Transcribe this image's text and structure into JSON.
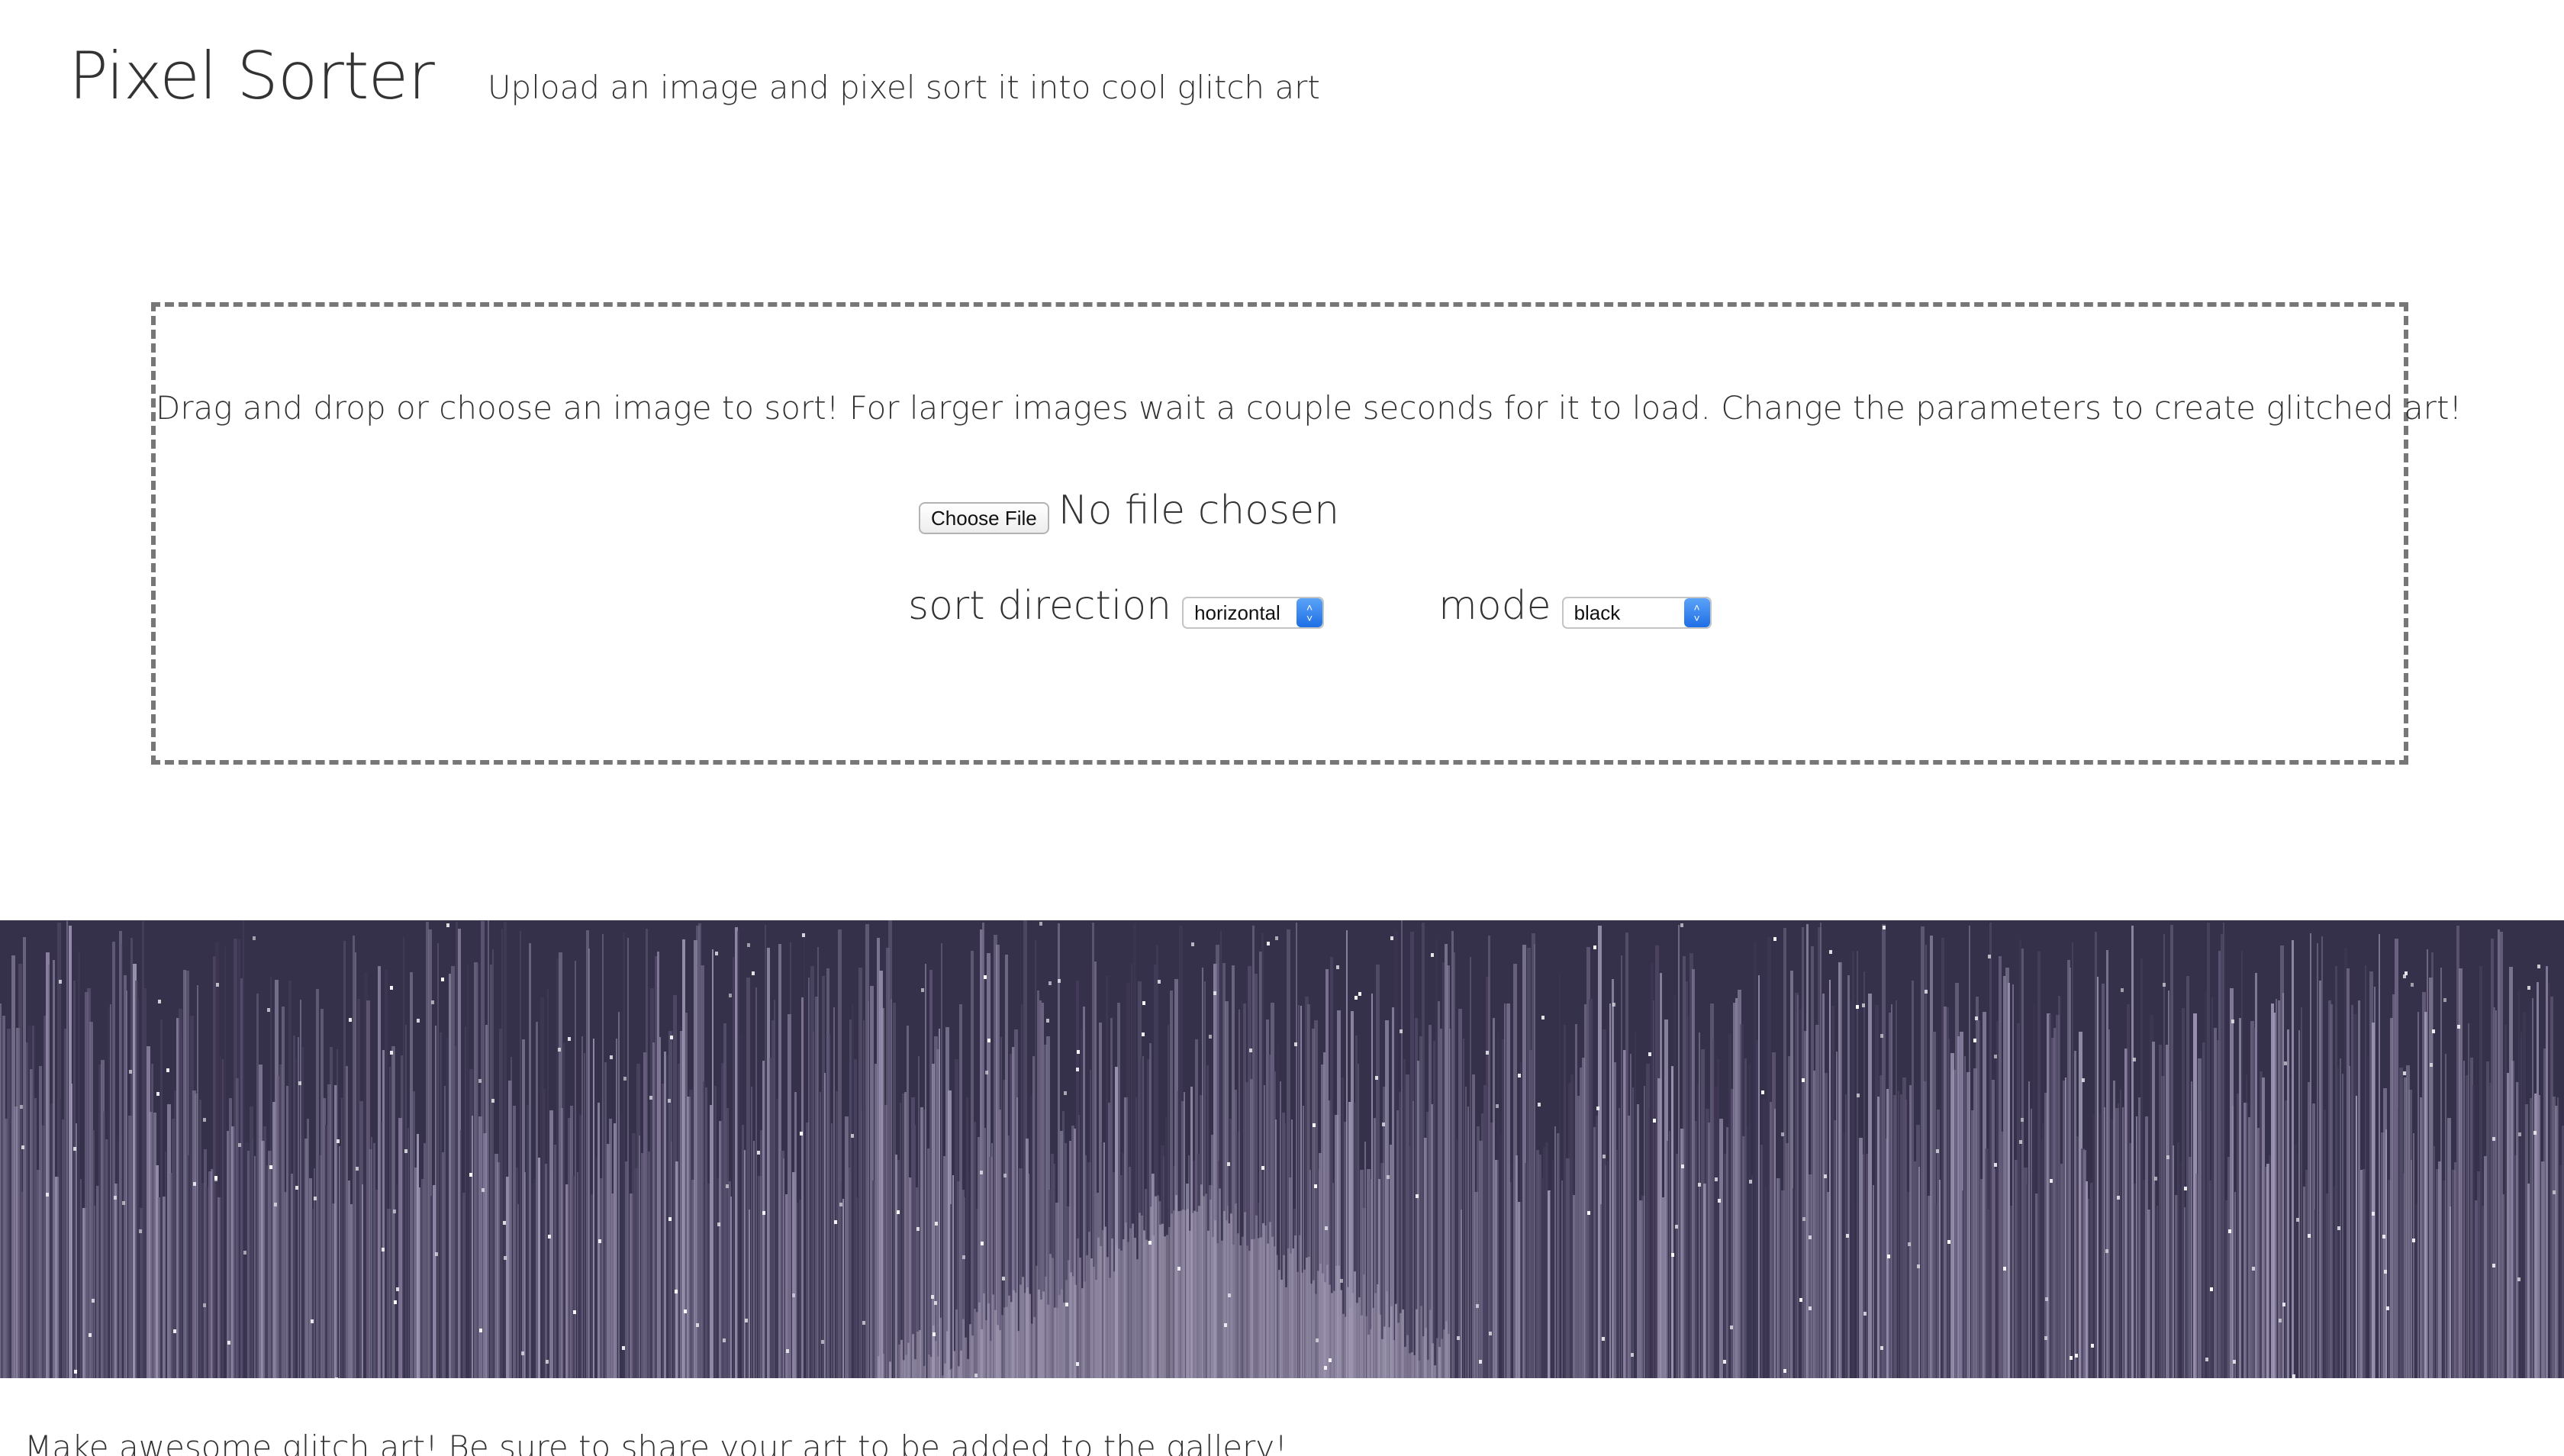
{
  "header": {
    "title": "Pixel Sorter",
    "tagline": "Upload an image and pixel sort it into cool glitch art"
  },
  "uploader": {
    "instructions": "Drag and drop or choose an image to sort! For larger images wait a couple seconds for it to load. Change the parameters to create glitched art!",
    "choose_file_label": "Choose File",
    "file_status": "No file chosen",
    "sort_direction_label": "sort direction",
    "sort_direction_value": "horizontal",
    "mode_label": "mode",
    "mode_value": "black"
  },
  "banner": {
    "description": "pixel-sorted glitch art image",
    "colors": {
      "base": "#3a3650",
      "light": "#a49cb4",
      "dark": "#1f1c30"
    }
  },
  "footer": {
    "text": "Make awesome glitch art! Be sure to share your art to be added to the gallery!"
  },
  "icons": {
    "select_arrows": "up-down-chevron-icon"
  }
}
